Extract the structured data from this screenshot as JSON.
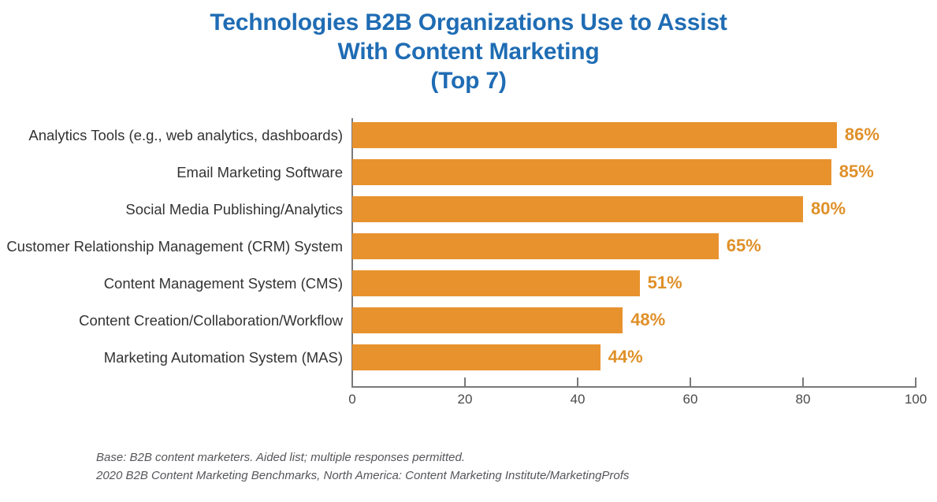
{
  "chart_data": {
    "type": "bar",
    "orientation": "horizontal",
    "title": "Technologies B2B Organizations Use to Assist With Content Marketing (Top 7)",
    "title_lines": [
      "Technologies B2B Organizations Use to Assist",
      "With Content Marketing",
      "(Top 7)"
    ],
    "categories": [
      "Analytics Tools (e.g., web analytics, dashboards)",
      "Email Marketing Software",
      "Social Media Publishing/Analytics",
      "Customer Relationship Management (CRM) System",
      "Content Management System (CMS)",
      "Content Creation/Collaboration/Workflow",
      "Marketing Automation System (MAS)"
    ],
    "values": [
      86,
      85,
      80,
      65,
      51,
      48,
      44
    ],
    "value_labels": [
      "86%",
      "85%",
      "80%",
      "65%",
      "51%",
      "48%",
      "44%"
    ],
    "xlabel": "",
    "ylabel": "",
    "xlim": [
      0,
      100
    ],
    "xticks": [
      0,
      20,
      40,
      60,
      80,
      100
    ],
    "xtick_labels": [
      "0",
      "20",
      "40",
      "60",
      "80",
      "100"
    ],
    "grid": false,
    "legend": false,
    "bar_color": "#e8922e",
    "value_label_color": "#df9028",
    "title_color": "#1f6cb4",
    "category_label_color": "#333333",
    "axis_color": "#7a7a7a"
  },
  "footnotes": [
    "Base: B2B content marketers. Aided list; multiple responses permitted.",
    "2020 B2B Content Marketing Benchmarks, North America: Content Marketing Institute/MarketingProfs"
  ]
}
